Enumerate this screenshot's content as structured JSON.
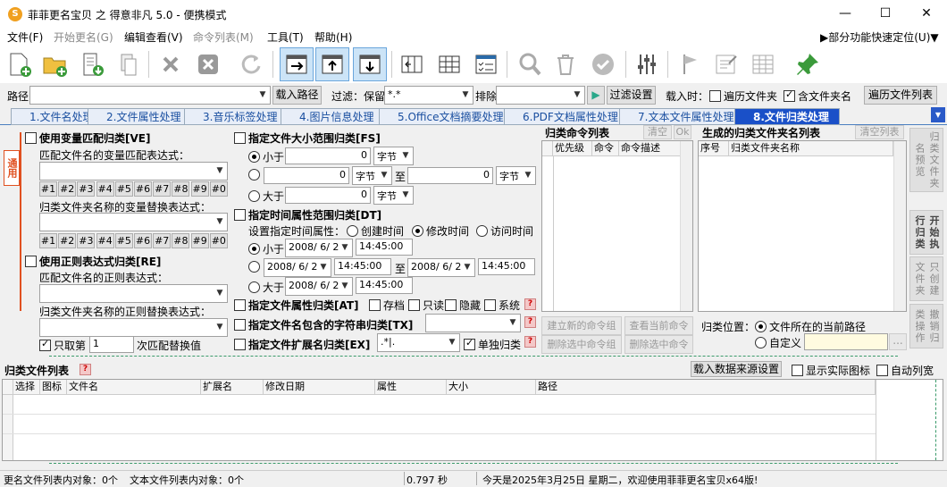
{
  "window": {
    "title": "菲菲更名宝贝 之 得意非凡 5.0 - 便携模式",
    "minimize": "—",
    "maximize": "☐",
    "close": "✕"
  },
  "menu": {
    "items": [
      "文件(F)",
      "开始更名(G)",
      "编辑查看(V)",
      "命令列表(M)",
      "工具(T)",
      "帮助(H)"
    ],
    "quick_access": "▶部分功能快速定位(U)▼"
  },
  "toolbar": {
    "icons": [
      "new-file-icon",
      "add-folder-icon",
      "import-icon",
      "copy-doc-icon",
      "delete-x-icon",
      "clear-icon",
      "refresh-icon",
      "arrow-right-icon",
      "arrow-up-icon",
      "arrow-down-icon",
      "column-left-icon",
      "columns-icon",
      "checklist-icon",
      "search-icon",
      "trash-icon",
      "check-icon",
      "sliders-icon",
      "flag-icon",
      "edit-doc-icon",
      "table-icon",
      "pin-icon"
    ]
  },
  "pathbar": {
    "path_label": "路径",
    "path_value": "",
    "load_path": "载入路径",
    "filter_label": "过滤：保留",
    "filter_value": "*.*",
    "exclude_label": "排除",
    "exclude_value": "",
    "filter_settings": "过滤设置",
    "load_when": "载入时：",
    "traverse_files": "遍历文件夹",
    "include_folder_name": "含文件夹名",
    "traverse_file_list": "遍历文件列表"
  },
  "tabs": [
    "1.文件名处理",
    "2.文件属性处理",
    "3.音乐标签处理",
    "4.图片信息处理",
    "5.Office文档摘要处理",
    "6.PDF文档属性处理",
    "7.文本文件属性处理",
    "8.文件归类处理"
  ],
  "side_tab": "通用",
  "left": {
    "var_match": "使用变量匹配归类[VE]",
    "var_expr_label": "匹配文件名的变量匹配表达式：",
    "hash_buttons": [
      "#1",
      "#2",
      "#3",
      "#4",
      "#5",
      "#6",
      "#7",
      "#8",
      "#9",
      "#0"
    ],
    "var_replace_label": "归类文件夹名称的变量替换表达式：",
    "regex": "使用正则表达式归类[RE]",
    "regex_expr_label": "匹配文件名的正则表达式：",
    "regex_replace_label": "归类文件夹名称的正则替换表达式：",
    "only_take": "只取第",
    "only_take_value": "1",
    "match_suffix": "次匹配替换值"
  },
  "middle": {
    "size_range": "指定文件大小范围归类[FS]",
    "less_than": "小于",
    "greater_than": "大于",
    "to": "至",
    "unit": "字节",
    "zero": "0",
    "time_range": "指定时间属性范围归类[DT]",
    "time_attr_label": "设置指定时间属性：",
    "created": "创建时间",
    "modified": "修改时间",
    "accessed": "访问时间",
    "date": "2008/ 6/ 2",
    "time": "14:45:00",
    "attr": "指定文件属性归类[AT]",
    "archive": "存档",
    "readonly": "只读",
    "hidden": "隐藏",
    "system": "系统",
    "name_contains": "指定文件名包含的字符串归类[TX]",
    "ext": "指定文件扩展名归类[EX]",
    "ext_value": ".*|.",
    "single_class": "单独归类"
  },
  "cmdlist": {
    "title": "归类命令列表",
    "clear": "清空",
    "ok": "Ok",
    "headers": [
      "优先级",
      "命令",
      "命令描述"
    ],
    "create_group": "建立新的命令组",
    "view_cmd": "查看当前命令",
    "delete_group": "删除选中命令组",
    "delete_cmd": "删除选中命令"
  },
  "folders": {
    "title": "生成的归类文件夹名列表",
    "clear": "清空列表",
    "headers": [
      "序号",
      "归类文件夹名称"
    ],
    "location_label": "归类位置：",
    "current_path": "文件所在的当前路径",
    "custom": "自定义",
    "browse": "..."
  },
  "side_buttons": [
    "归类文件夹名预览",
    "开始执行归类",
    "只创建文件夹",
    "撤销归类操作"
  ],
  "filelist": {
    "title": "归类文件列表",
    "load_source": "载入数据来源设置",
    "show_icons": "显示实际图标",
    "auto_width": "自动列宽",
    "headers": [
      "选择",
      "图标",
      "文件名",
      "扩展名",
      "修改日期",
      "属性",
      "大小",
      "路径"
    ]
  },
  "status": {
    "rename_count": "更名文件列表内对象：0个",
    "text_count": "文本文件列表内对象：0个",
    "elapsed": "0.797 秒",
    "message": "今天是2025年3月25日 星期二，欢迎使用菲菲更名宝贝x64版!"
  }
}
